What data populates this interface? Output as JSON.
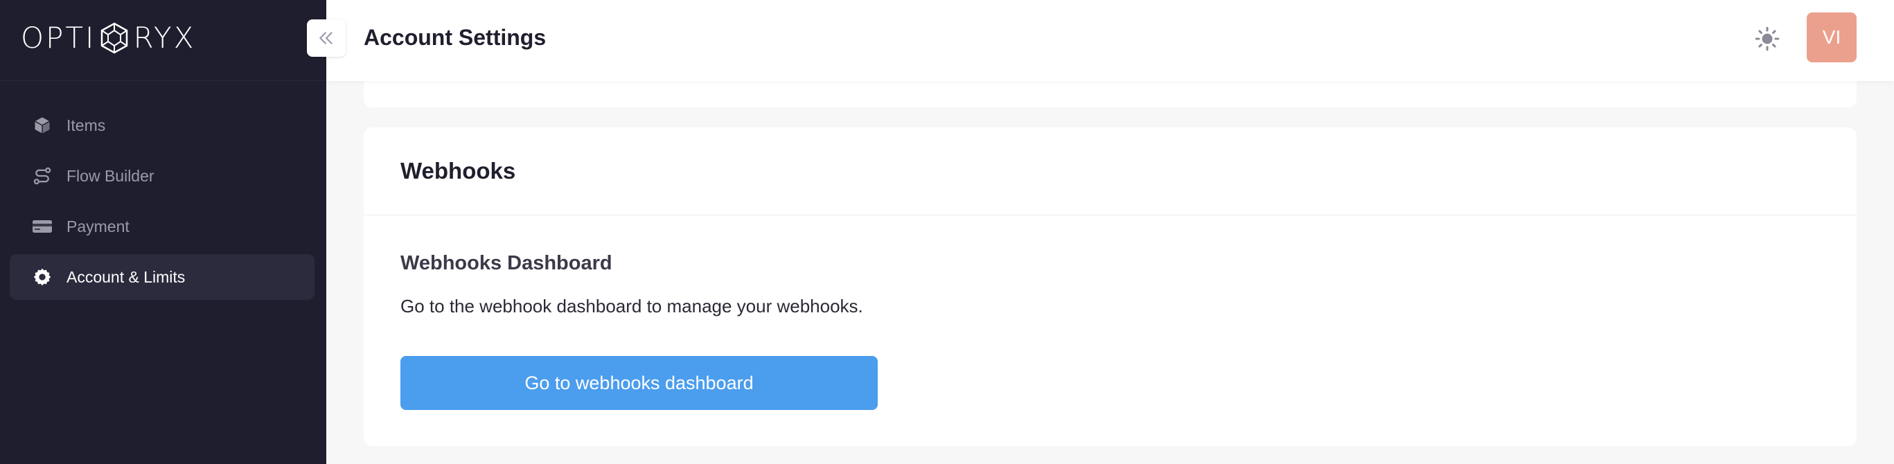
{
  "brand": {
    "name_left": "OPTI",
    "name_right": "RYX"
  },
  "sidebar": {
    "items": [
      {
        "label": "Items",
        "icon": "cube-icon",
        "active": false
      },
      {
        "label": "Flow Builder",
        "icon": "route-icon",
        "active": false
      },
      {
        "label": "Payment",
        "icon": "credit-card-icon",
        "active": false
      },
      {
        "label": "Account & Limits",
        "icon": "gear-icon",
        "active": true
      }
    ]
  },
  "header": {
    "title": "Account Settings",
    "avatar_initials": "VI"
  },
  "webhooks": {
    "card_title": "Webhooks",
    "section_title": "Webhooks Dashboard",
    "description": "Go to the webhook dashboard to manage your webhooks.",
    "button_label": "Go to webhooks dashboard"
  },
  "colors": {
    "sidebar_bg": "#1f1e2e",
    "active_item_bg": "#2c2b3d",
    "primary_button": "#4b9ded",
    "avatar_bg": "#eba08d"
  }
}
